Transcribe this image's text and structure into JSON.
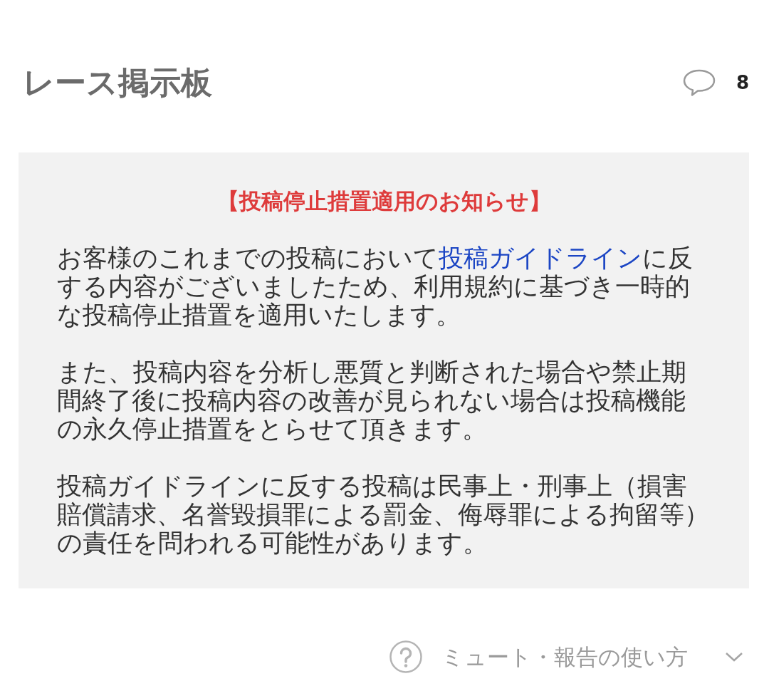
{
  "header": {
    "title": "レース掲示板",
    "comment_count": "8"
  },
  "notice": {
    "title": "【投稿停止措置適用のお知らせ】",
    "paragraphs": [
      [
        {
          "kind": "text",
          "text": "お客様のこれまでの投稿において"
        },
        {
          "kind": "link",
          "text": "投稿ガイドライン"
        },
        {
          "kind": "text",
          "text": "に反する内容がございましたため、利用規約に基づき一時的な投稿停止措置を適用いたします。"
        }
      ],
      [
        {
          "kind": "text",
          "text": "また、投稿内容を分析し悪質と判断された場合や禁止期間終了後に投稿内容の改善が見られない場合は投稿機能の永久停止措置をとらせて頂きます。"
        }
      ],
      [
        {
          "kind": "text",
          "text": "投稿ガイドラインに反する投稿は民事上・刑事上（損害賠償請求、名誉毀損罪による罰金、侮辱罪による拘留等）の責任を問われる可能性があります。"
        }
      ]
    ]
  },
  "help": {
    "label": "ミュート・報告の使い方",
    "expanded": false
  }
}
